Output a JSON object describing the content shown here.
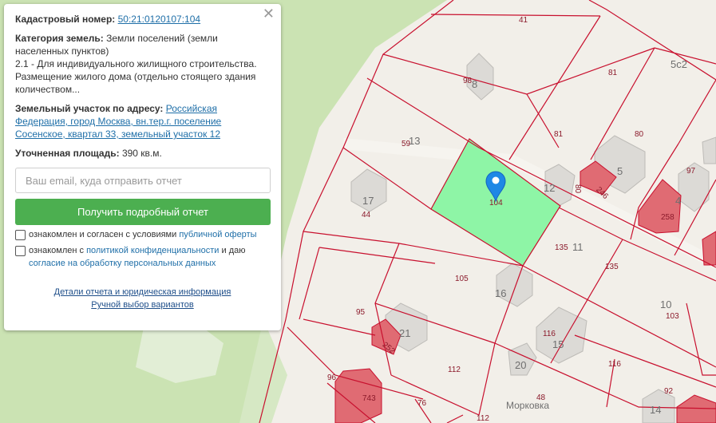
{
  "popup": {
    "close_glyph": "✕",
    "cadastral_label": "Кадастровый номер:",
    "cadastral_number": "50:21:0120107:104",
    "category_label": "Категория земель:",
    "category_value": "Земли поселений (земли населенных пунктов)",
    "usage_text": "2.1 - Для индивидуального жилищного строительства. Размещение жилого дома (отдельно стоящего здания количеством...",
    "address_label": "Земельный участок по адресу:",
    "address_value": "Российская Федерация, город Москва, вн.тер.г. поселение Сосенское, квартал 33, земельный участок 12",
    "area_label": "Уточненная площадь:",
    "area_value": "390 кв.м.",
    "email_placeholder": "Ваш email, куда отправить отчет",
    "report_button": "Получить подробный отчет",
    "consent1_text": "ознакомлен и согласен с условиями",
    "consent1_link": "публичной оферты",
    "consent2_text": "ознакомлен с",
    "consent2_link": "политикой конфиденциальности",
    "consent2_and": "и даю",
    "consent2_link2": "согласие на обработку персональных данных",
    "details_link": "Детали отчета и юридическая информация",
    "manual_link": "Ручной выбор вариантов"
  },
  "map": {
    "selected_color": "#8ef5a6",
    "boundary_color": "#c8102e",
    "street": "Морковка",
    "plot_labels": [
      "41",
      "98",
      "81",
      "5с2",
      "59",
      "81",
      "80",
      "97",
      "104",
      "80",
      "246",
      "258",
      "44",
      "135",
      "135",
      "105",
      "95",
      "103",
      "252",
      "112",
      "116",
      "96",
      "743",
      "76",
      "48",
      "112",
      "92"
    ],
    "building_numbers": [
      "8",
      "13",
      "5",
      "12",
      "4",
      "17",
      "11",
      "16",
      "10",
      "21",
      "15",
      "20",
      "14"
    ]
  }
}
